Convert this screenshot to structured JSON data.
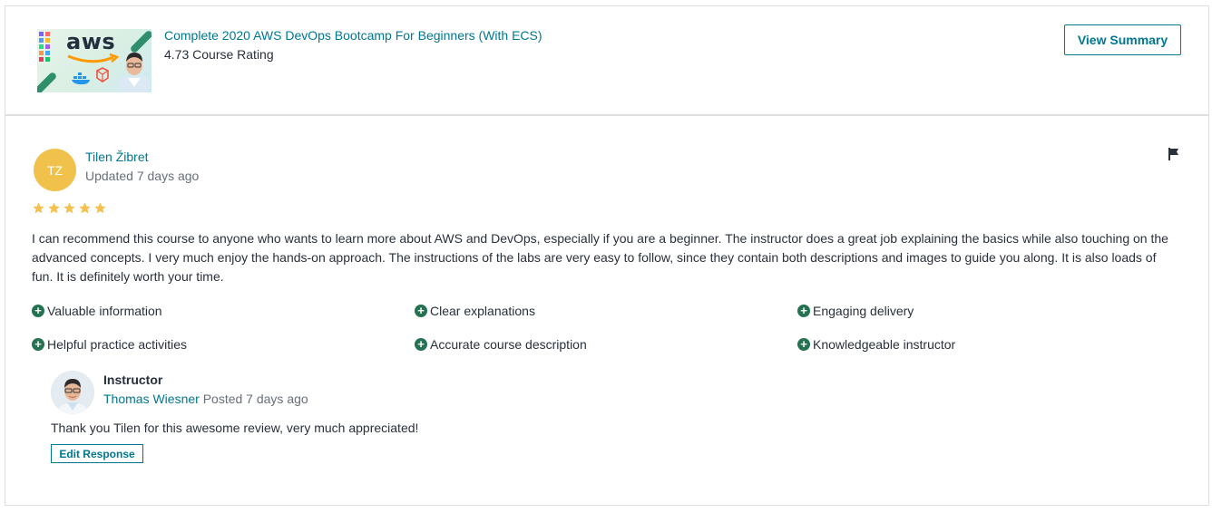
{
  "course": {
    "thumbnail_text": "aws",
    "title": "Complete 2020 AWS DevOps Bootcamp For Beginners (With ECS)",
    "rating_text": "4.73 Course Rating",
    "view_summary_label": "View Summary"
  },
  "review": {
    "avatar_initials": "TZ",
    "reviewer_name": "Tilen Žibret",
    "updated": "Updated 7 days ago",
    "rating": 5,
    "text": "I can recommend this course to anyone who wants to learn more about AWS and DevOps, especially if you are a beginner. The instructor does a great job explaining the basics while also touching on the advanced concepts. I very much enjoy the hands-on approach. The instructions of the labs are very easy to follow, since they contain both descriptions and images to guide you along. It is also loads of fun. It is definitely worth your time.",
    "tags": [
      "Valuable information",
      "Clear explanations",
      "Engaging delivery",
      "Helpful practice activities",
      "Accurate course description",
      "Knowledgeable instructor"
    ]
  },
  "response": {
    "label": "Instructor",
    "instructor_name": "Thomas Wiesner",
    "posted": "Posted 7 days ago",
    "text": "Thank you Tilen for this awesome review, very much appreciated!",
    "edit_label": "Edit Response"
  },
  "colors": {
    "link": "#007791",
    "star": "#f4c150",
    "tag_icon": "#257253",
    "avatar_bg": "#f0c14b"
  },
  "icons": [
    "flag-icon",
    "star-icon",
    "plus-circle-icon"
  ]
}
